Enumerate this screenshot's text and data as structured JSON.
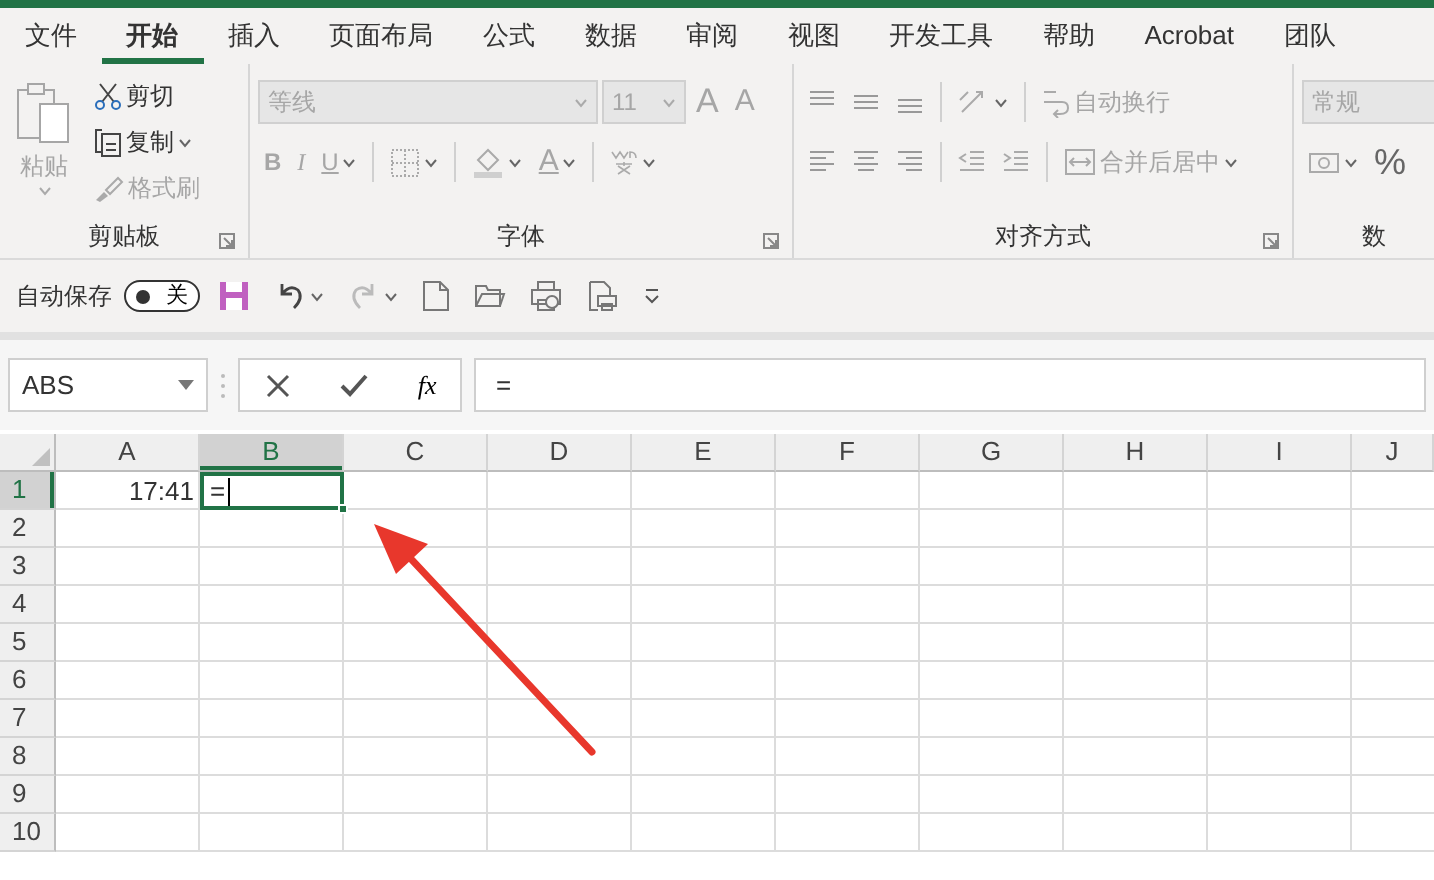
{
  "ribbon_tabs": [
    {
      "label": "文件",
      "selected": false
    },
    {
      "label": "开始",
      "selected": true
    },
    {
      "label": "插入",
      "selected": false
    },
    {
      "label": "页面布局",
      "selected": false
    },
    {
      "label": "公式",
      "selected": false
    },
    {
      "label": "数据",
      "selected": false
    },
    {
      "label": "审阅",
      "selected": false
    },
    {
      "label": "视图",
      "selected": false
    },
    {
      "label": "开发工具",
      "selected": false
    },
    {
      "label": "帮助",
      "selected": false
    },
    {
      "label": "Acrobat",
      "selected": false
    },
    {
      "label": "团队",
      "selected": false
    }
  ],
  "clipboard": {
    "paste": {
      "label": "粘贴",
      "disabled": true
    },
    "cut": {
      "label": "剪切",
      "disabled": false
    },
    "copy": {
      "label": "复制",
      "disabled": false
    },
    "format_painter": {
      "label": "格式刷",
      "disabled": true
    },
    "group_label": "剪贴板"
  },
  "font": {
    "disabled": true,
    "font_name": "等线",
    "font_size": "11",
    "grow_label": "A",
    "shrink_label": "A",
    "bold": "B",
    "italic": "I",
    "underline": "U",
    "font_color": "A",
    "group_label": "字体"
  },
  "alignment": {
    "disabled": true,
    "wrap_text": "自动换行",
    "merge_center": "合并后居中",
    "group_label": "对齐方式"
  },
  "number": {
    "disabled": true,
    "format": "常规",
    "percent": "%",
    "group_label": "数"
  },
  "quick_access": {
    "autosave_label": "自动保存",
    "autosave_on": false,
    "autosave_state": "关",
    "undo_disabled": false,
    "redo_disabled": true
  },
  "formula_bar": {
    "name_box": "ABS",
    "fx": "fx",
    "formula": "="
  },
  "sheet": {
    "columns": [
      {
        "label": "A",
        "selected": false
      },
      {
        "label": "B",
        "selected": true
      },
      {
        "label": "C",
        "selected": false
      },
      {
        "label": "D",
        "selected": false
      },
      {
        "label": "E",
        "selected": false
      },
      {
        "label": "F",
        "selected": false
      },
      {
        "label": "G",
        "selected": false
      },
      {
        "label": "H",
        "selected": false
      },
      {
        "label": "I",
        "selected": false
      },
      {
        "label": "J",
        "selected": false
      }
    ],
    "rows": [
      {
        "label": "1",
        "selected": true,
        "cells": [
          {
            "text": "17:41",
            "kind": "number"
          },
          {
            "text": "=",
            "kind": "editing"
          }
        ]
      },
      {
        "label": "2",
        "selected": false
      },
      {
        "label": "3",
        "selected": false
      },
      {
        "label": "4",
        "selected": false
      },
      {
        "label": "5",
        "selected": false
      },
      {
        "label": "6",
        "selected": false
      },
      {
        "label": "7",
        "selected": false
      },
      {
        "label": "8",
        "selected": false
      },
      {
        "label": "9",
        "selected": false
      },
      {
        "label": "10",
        "selected": false
      }
    ]
  }
}
